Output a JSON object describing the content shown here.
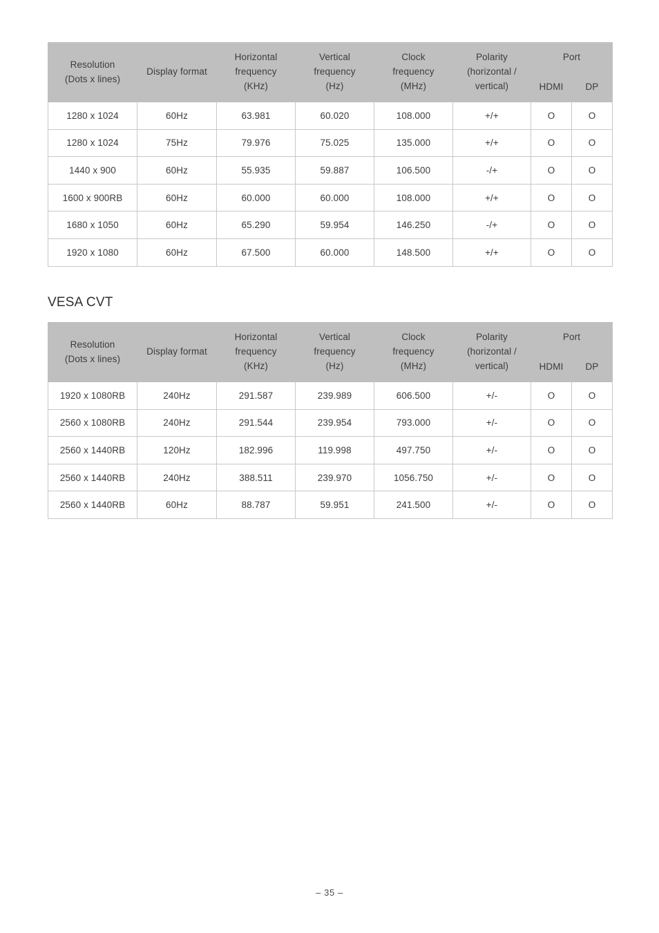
{
  "page": {
    "footer_label": "– 35 –"
  },
  "sections": [
    {
      "heading": "",
      "table": {
        "headers": {
          "resolution_line1": "Resolution",
          "resolution_line2": "(Dots x lines)",
          "display_format": "Display format",
          "h_freq_line1": "Horizontal",
          "h_freq_line2": "frequency",
          "h_freq_line3": "(KHz)",
          "v_freq_line1": "Vertical",
          "v_freq_line2": "frequency",
          "v_freq_line3": "(Hz)",
          "clock_line1": "Clock",
          "clock_line2": "frequency",
          "clock_line3": "(MHz)",
          "polarity_line1": "Polarity",
          "polarity_line2": "(horizontal /",
          "polarity_line3": "vertical)",
          "port_group": "Port",
          "port_hdmi": "HDMI",
          "port_dp": "DP"
        },
        "rows": [
          {
            "resolution": "1280 x 1024",
            "format": "60Hz",
            "hfreq": "63.981",
            "vfreq": "60.020",
            "clock": "108.000",
            "polarity": "+/+",
            "hdmi": "O",
            "dp": "O"
          },
          {
            "resolution": "1280 x 1024",
            "format": "75Hz",
            "hfreq": "79.976",
            "vfreq": "75.025",
            "clock": "135.000",
            "polarity": "+/+",
            "hdmi": "O",
            "dp": "O"
          },
          {
            "resolution": "1440 x 900",
            "format": "60Hz",
            "hfreq": "55.935",
            "vfreq": "59.887",
            "clock": "106.500",
            "polarity": "-/+",
            "hdmi": "O",
            "dp": "O"
          },
          {
            "resolution": "1600 x 900RB",
            "format": "60Hz",
            "hfreq": "60.000",
            "vfreq": "60.000",
            "clock": "108.000",
            "polarity": "+/+",
            "hdmi": "O",
            "dp": "O"
          },
          {
            "resolution": "1680 x 1050",
            "format": "60Hz",
            "hfreq": "65.290",
            "vfreq": "59.954",
            "clock": "146.250",
            "polarity": "-/+",
            "hdmi": "O",
            "dp": "O"
          },
          {
            "resolution": "1920 x 1080",
            "format": "60Hz",
            "hfreq": "67.500",
            "vfreq": "60.000",
            "clock": "148.500",
            "polarity": "+/+",
            "hdmi": "O",
            "dp": "O"
          }
        ]
      }
    },
    {
      "heading": "VESA CVT",
      "table": {
        "headers": {
          "resolution_line1": "Resolution",
          "resolution_line2": "(Dots x lines)",
          "display_format": "Display format",
          "h_freq_line1": "Horizontal",
          "h_freq_line2": "frequency",
          "h_freq_line3": "(KHz)",
          "v_freq_line1": "Vertical",
          "v_freq_line2": "frequency",
          "v_freq_line3": "(Hz)",
          "clock_line1": "Clock",
          "clock_line2": "frequency",
          "clock_line3": "(MHz)",
          "polarity_line1": "Polarity",
          "polarity_line2": "(horizontal /",
          "polarity_line3": "vertical)",
          "port_group": "Port",
          "port_hdmi": "HDMI",
          "port_dp": "DP"
        },
        "rows": [
          {
            "resolution": "1920 x 1080RB",
            "format": "240Hz",
            "hfreq": "291.587",
            "vfreq": "239.989",
            "clock": "606.500",
            "polarity": "+/-",
            "hdmi": "O",
            "dp": "O"
          },
          {
            "resolution": "2560 x 1080RB",
            "format": "240Hz",
            "hfreq": "291.544",
            "vfreq": "239.954",
            "clock": "793.000",
            "polarity": "+/-",
            "hdmi": "O",
            "dp": "O"
          },
          {
            "resolution": "2560 x 1440RB",
            "format": "120Hz",
            "hfreq": "182.996",
            "vfreq": "119.998",
            "clock": "497.750",
            "polarity": "+/-",
            "hdmi": "O",
            "dp": "O"
          },
          {
            "resolution": "2560 x 1440RB",
            "format": "240Hz",
            "hfreq": "388.511",
            "vfreq": "239.970",
            "clock": "1056.750",
            "polarity": "+/-",
            "hdmi": "O",
            "dp": "O"
          },
          {
            "resolution": "2560 x 1440RB",
            "format": "60Hz",
            "hfreq": "88.787",
            "vfreq": "59.951",
            "clock": "241.500",
            "polarity": "+/-",
            "hdmi": "O",
            "dp": "O"
          }
        ]
      }
    }
  ]
}
